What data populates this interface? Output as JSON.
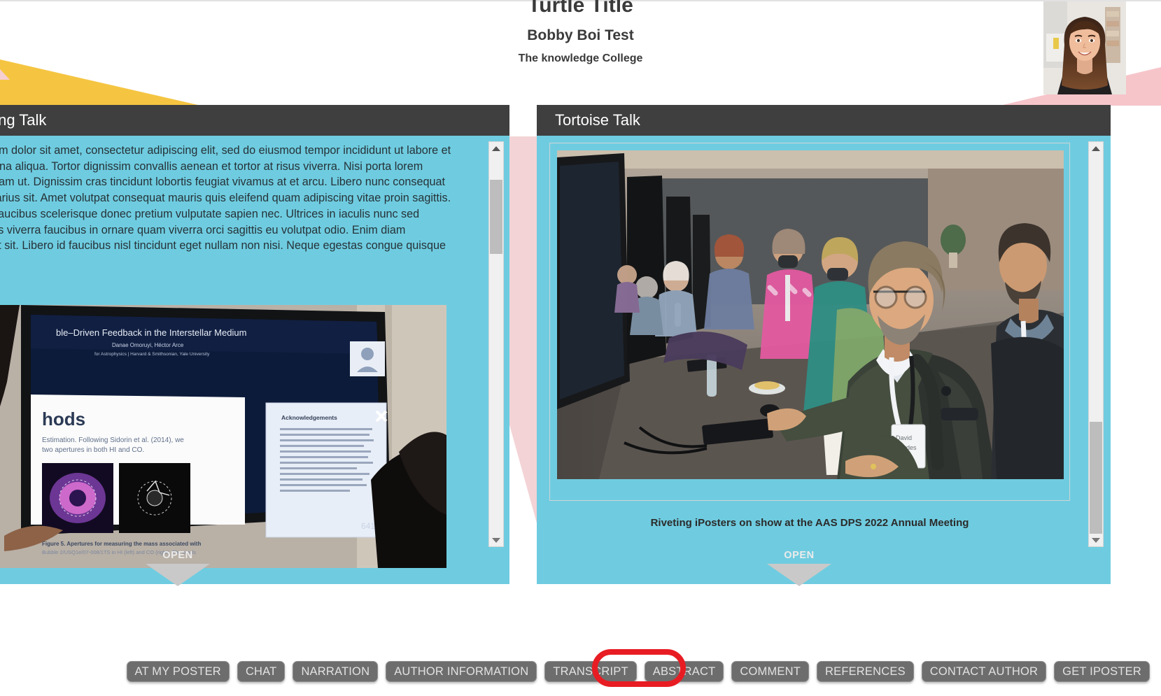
{
  "header": {
    "title": "Turtle Title",
    "author": "Bobby Boi Test",
    "affiliation": "The knowledge College",
    "avatar_alt": "presenter-headshot"
  },
  "colors": {
    "panel_header": "#3f3f3f",
    "panel_body": "#6FCCE0",
    "accent_yellow": "#F5C542",
    "accent_pink": "#F3D3D6",
    "highlight_red": "#E81C23",
    "toolbar_button": "#6d6d6d"
  },
  "panels": [
    {
      "id": "left",
      "title": "Amazing Talk",
      "title_visible": "ng Talk",
      "body_text": "Lorem ipsum dolor sit amet, consectetur adipiscing elit, sed do eiusmod tempor incididunt ut labore et dolore magna aliqua. Tortor dignissim convallis aenean et tortor at risus viverra. Nisi porta lorem mollis aliquam ut. Dignissim cras tincidunt lobortis feugiat vivamus at et arcu. Libero nunc consequat interdum varius sit. Amet volutpat consequat mauris quis eleifend quam adipiscing vitae proin sagittis. Phasellus faucibus scelerisque donec pretium vulputate sapien nec. Ultrices in iaculis nunc sed augue lacus viverra faucibus in ornare quam viverra orci sagittis eu volutpat odio. Enim diam vulputate ut sit. Libero id faucibus nisl tincidunt eget nullam non nisi. Neque egestas congue quisque",
      "image_alt": "researcher-viewing-iposter-screen",
      "open_label": "OPEN",
      "scroll_thumb_position": "near-top"
    },
    {
      "id": "right",
      "title": "Tortoise Talk",
      "image_alt": "conference-attendees-at-iposter-kiosks",
      "caption": "Riveting iPosters on show at the AAS DPS 2022 Annual Meeting",
      "open_label": "OPEN",
      "scroll_thumb_position": "near-bottom"
    }
  ],
  "toolbar": {
    "buttons": [
      {
        "label": "AT MY POSTER",
        "highlighted": false
      },
      {
        "label": "CHAT",
        "highlighted": false
      },
      {
        "label": "NARRATION",
        "highlighted": false
      },
      {
        "label": "AUTHOR INFORMATION",
        "highlighted": false
      },
      {
        "label": "TRANSCRIPT",
        "highlighted": true
      },
      {
        "label": "ABSTRACT",
        "highlighted": false
      },
      {
        "label": "COMMENT",
        "highlighted": false
      },
      {
        "label": "REFERENCES",
        "highlighted": false
      },
      {
        "label": "CONTACT AUTHOR",
        "highlighted": false
      },
      {
        "label": "GET IPOSTER",
        "highlighted": false
      }
    ]
  },
  "embedded_poster": {
    "title": "Bubble-Driven Feedback in the Interstellar Medium",
    "authors": "Danae Omoruyi, Héctor Arce",
    "institutions": "Center for Astrophysics | Harvard & Smithsonian, Yale University",
    "section_heading": "Methods",
    "popup_title": "Acknowledgements",
    "figure_caption": "Figure 5. Apertures for measuring the mass associated with Bubble"
  }
}
